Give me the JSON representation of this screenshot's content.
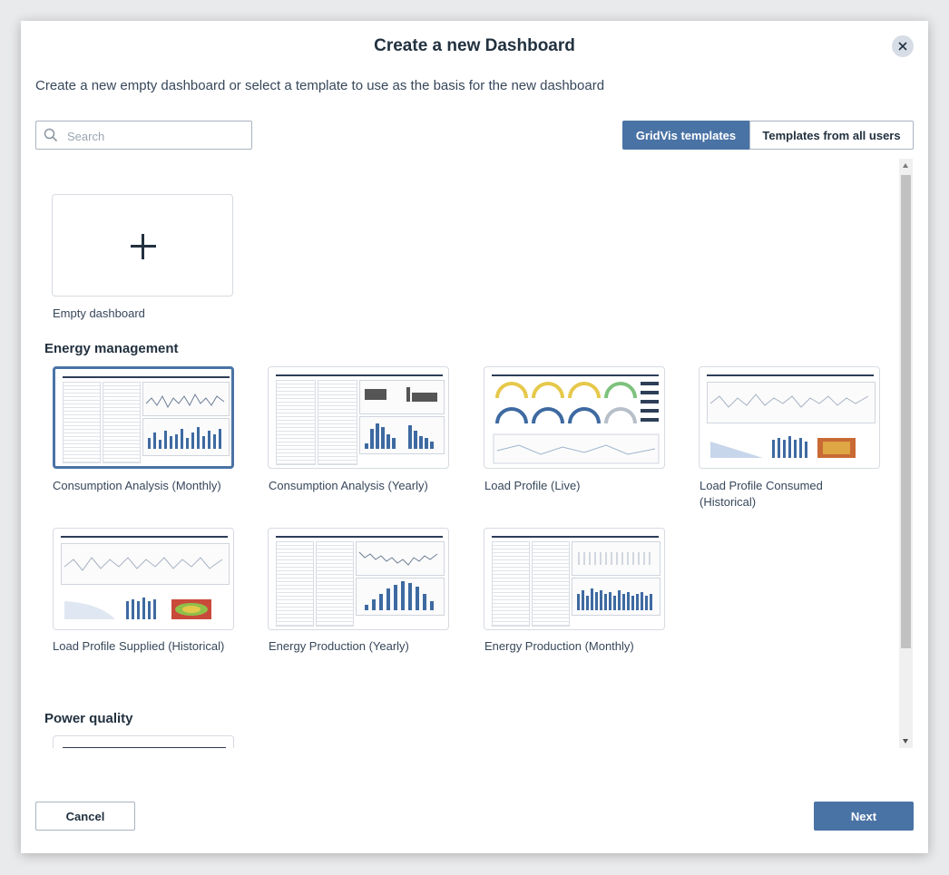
{
  "dialog": {
    "title": "Create a new Dashboard",
    "subtitle": "Create a new empty dashboard or select a template to use as the basis for the new dashboard"
  },
  "search": {
    "placeholder": "Search",
    "value": ""
  },
  "tabs": [
    {
      "label": "GridVis templates",
      "active": true
    },
    {
      "label": "Templates from all users",
      "active": false
    }
  ],
  "empty": {
    "label": "Empty dashboard"
  },
  "sections": [
    {
      "title": "Energy management",
      "templates": [
        {
          "label": "Consumption Analysis (Monthly)",
          "selected": true
        },
        {
          "label": "Consumption Analysis (Yearly)",
          "selected": false
        },
        {
          "label": "Load Profile (Live)",
          "selected": false
        },
        {
          "label": "Load Profile Consumed (Historical)",
          "selected": false
        },
        {
          "label": "Load Profile Supplied (Historical)",
          "selected": false
        },
        {
          "label": "Energy Production (Yearly)",
          "selected": false
        },
        {
          "label": "Energy Production (Monthly)",
          "selected": false
        }
      ]
    },
    {
      "title": "Power quality"
    }
  ],
  "footer": {
    "cancel_label": "Cancel",
    "next_label": "Next"
  },
  "colors": {
    "accent": "#4a73a5",
    "heading": "#22313f"
  }
}
